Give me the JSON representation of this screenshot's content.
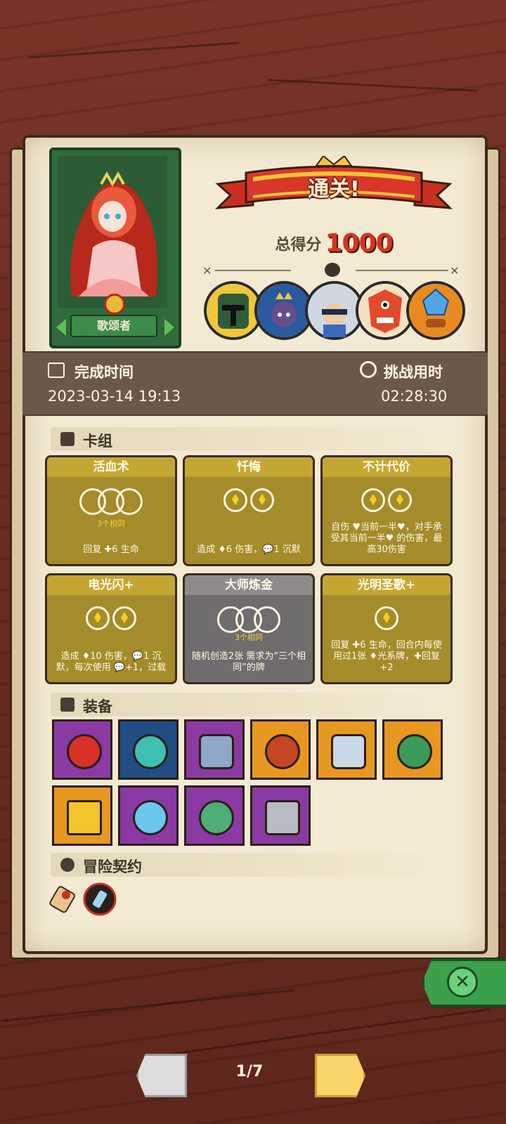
{
  "result": {
    "banner": "通关!",
    "score_label": "总得分",
    "score_value": "1000"
  },
  "hero": {
    "name": "歌颂者"
  },
  "bosses": [
    {
      "icon": "green-knight-boss-icon",
      "color": "#2f5d3a"
    },
    {
      "icon": "crowned-spider-boss-icon",
      "color": "#2a5aa0"
    },
    {
      "icon": "masked-child-boss-icon",
      "color": "#cfd8de"
    },
    {
      "icon": "tribal-mask-boss-icon",
      "color": "#e24a2a"
    },
    {
      "icon": "crystal-golem-boss-icon",
      "color": "#e88a1f"
    }
  ],
  "info": {
    "finish_label": "完成时间",
    "finish_value": "2023-03-14 19:13",
    "duration_label": "挑战用时",
    "duration_value": "02:28:30"
  },
  "sections": {
    "deck": "卡组",
    "equipment": "装备",
    "contracts": "冒险契约"
  },
  "cards": [
    {
      "title": "活血术",
      "same": "3个相同",
      "desc": "回复 ✚6 生命"
    },
    {
      "title": "忏悔",
      "same": "",
      "desc": "造成 ♦6 伤害，💬1 沉默"
    },
    {
      "title": "不计代价",
      "same": "",
      "desc": "自伤 ♥当前一半♥，对手承受其当前一半♥ 的伤害，最高30伤害"
    },
    {
      "title": "电光闪+",
      "same": "",
      "desc": "造成 ♦10 伤害，💬1 沉默，每次使用 💬+1，过载"
    },
    {
      "title": "大师炼金",
      "same": "3个相同",
      "desc": "随机创造2张 需求为“三个相同”的牌"
    },
    {
      "title": "光明圣歌+",
      "same": "",
      "desc": "回复 ✚6 生命，回合内每使用过1张 ♦光系牌，✚回复+2"
    }
  ],
  "equipment": [
    {
      "icon": "ruby-ring-icon",
      "bg": "purple"
    },
    {
      "icon": "emerald-ring-icon",
      "bg": "blue"
    },
    {
      "icon": "horn-icon",
      "bg": "purple"
    },
    {
      "icon": "lava-stone-icon",
      "bg": "orange"
    },
    {
      "icon": "cornucopia-icon",
      "bg": "orange"
    },
    {
      "icon": "turtle-shell-icon",
      "bg": "orange"
    },
    {
      "icon": "gold-crown-icon",
      "bg": "orange"
    },
    {
      "icon": "diamond-ring-icon",
      "bg": "purple"
    },
    {
      "icon": "leaf-ring-icon",
      "bg": "purple"
    },
    {
      "icon": "cube-icon",
      "bg": "purple"
    }
  ],
  "contracts": [
    {
      "icon": "scroll-icon"
    },
    {
      "icon": "potion-vial-icon"
    }
  ],
  "nav": {
    "page": "1/7"
  }
}
